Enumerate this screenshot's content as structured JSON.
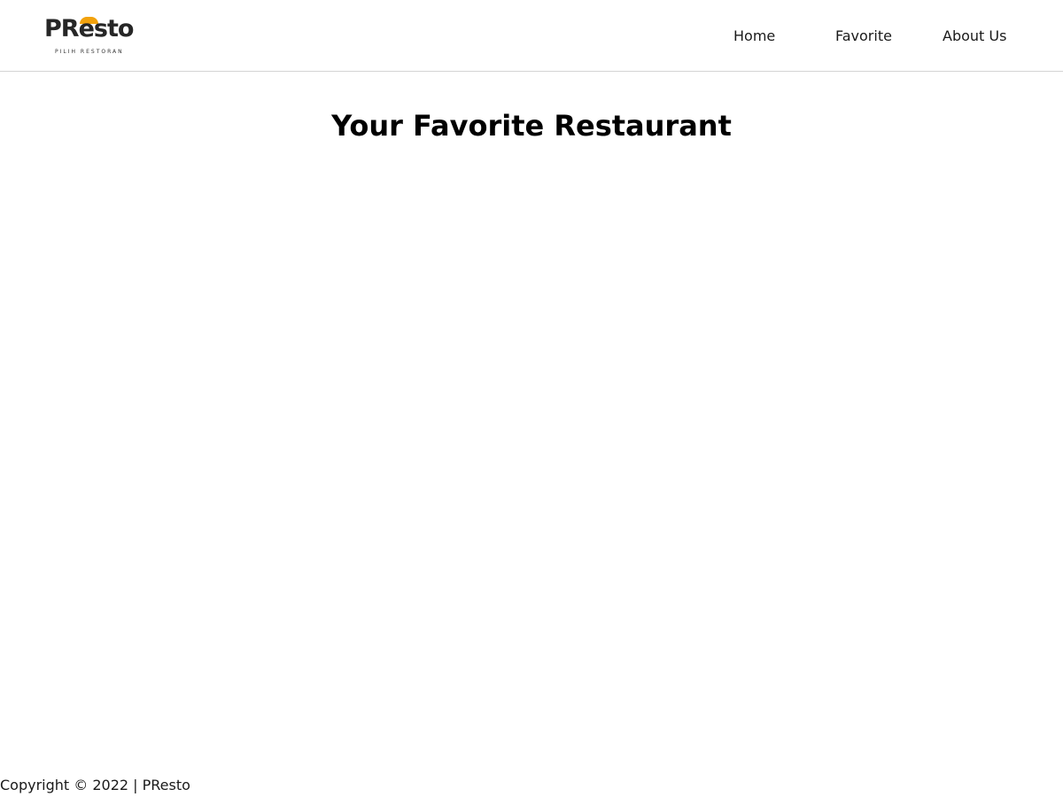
{
  "header": {
    "logo": {
      "name": "PResto",
      "tagline": "PILIH RESTORAN",
      "accent_color": "#f2a20d"
    },
    "nav": [
      {
        "label": "Home"
      },
      {
        "label": "Favorite"
      },
      {
        "label": "About Us"
      }
    ]
  },
  "main": {
    "title": "Your Favorite Restaurant"
  },
  "footer": {
    "copyright": "Copyright © 2022 | PResto"
  }
}
